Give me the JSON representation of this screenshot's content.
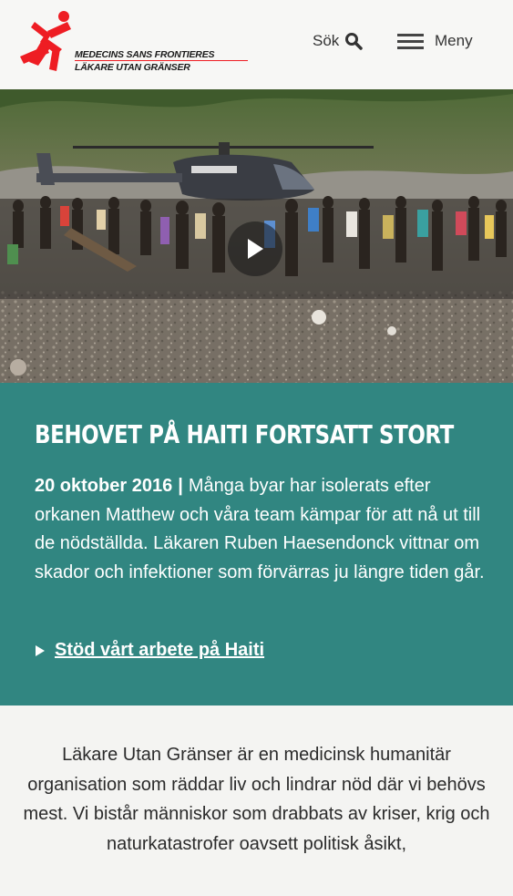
{
  "header": {
    "logo_line1": "MEDECINS SANS FRONTIERES",
    "logo_line2": "LÄKARE UTAN GRÄNSER",
    "search_label": "Sök",
    "menu_label": "Meny"
  },
  "hero": {
    "image_label": "",
    "play_button": "play"
  },
  "feature": {
    "headline": "Behovet på Haiti fortsatt stort",
    "date": "20 oktober 2016",
    "separator": "|",
    "summary": "Många byar har isolerats efter orkanen Matthew och våra team kämpar för att nå ut till de nödställda. Läkaren Ruben Haesendonck vittnar om skador och infektioner som förvärras ju längre tiden går.",
    "cta_label": "Stöd vårt arbete på Haiti",
    "background_color": "#318681"
  },
  "about": {
    "text": "Läkare Utan Gränser är en medicinsk humanitär organisation som räddar liv och lindrar nöd där vi behövs mest. Vi bistår människor som drabbats av kriser, krig och naturkatastrofer oavsett politisk åsikt,"
  },
  "colors": {
    "brand_red": "#ee1d23",
    "teal": "#318681",
    "page_bg": "#f4f4f2"
  }
}
